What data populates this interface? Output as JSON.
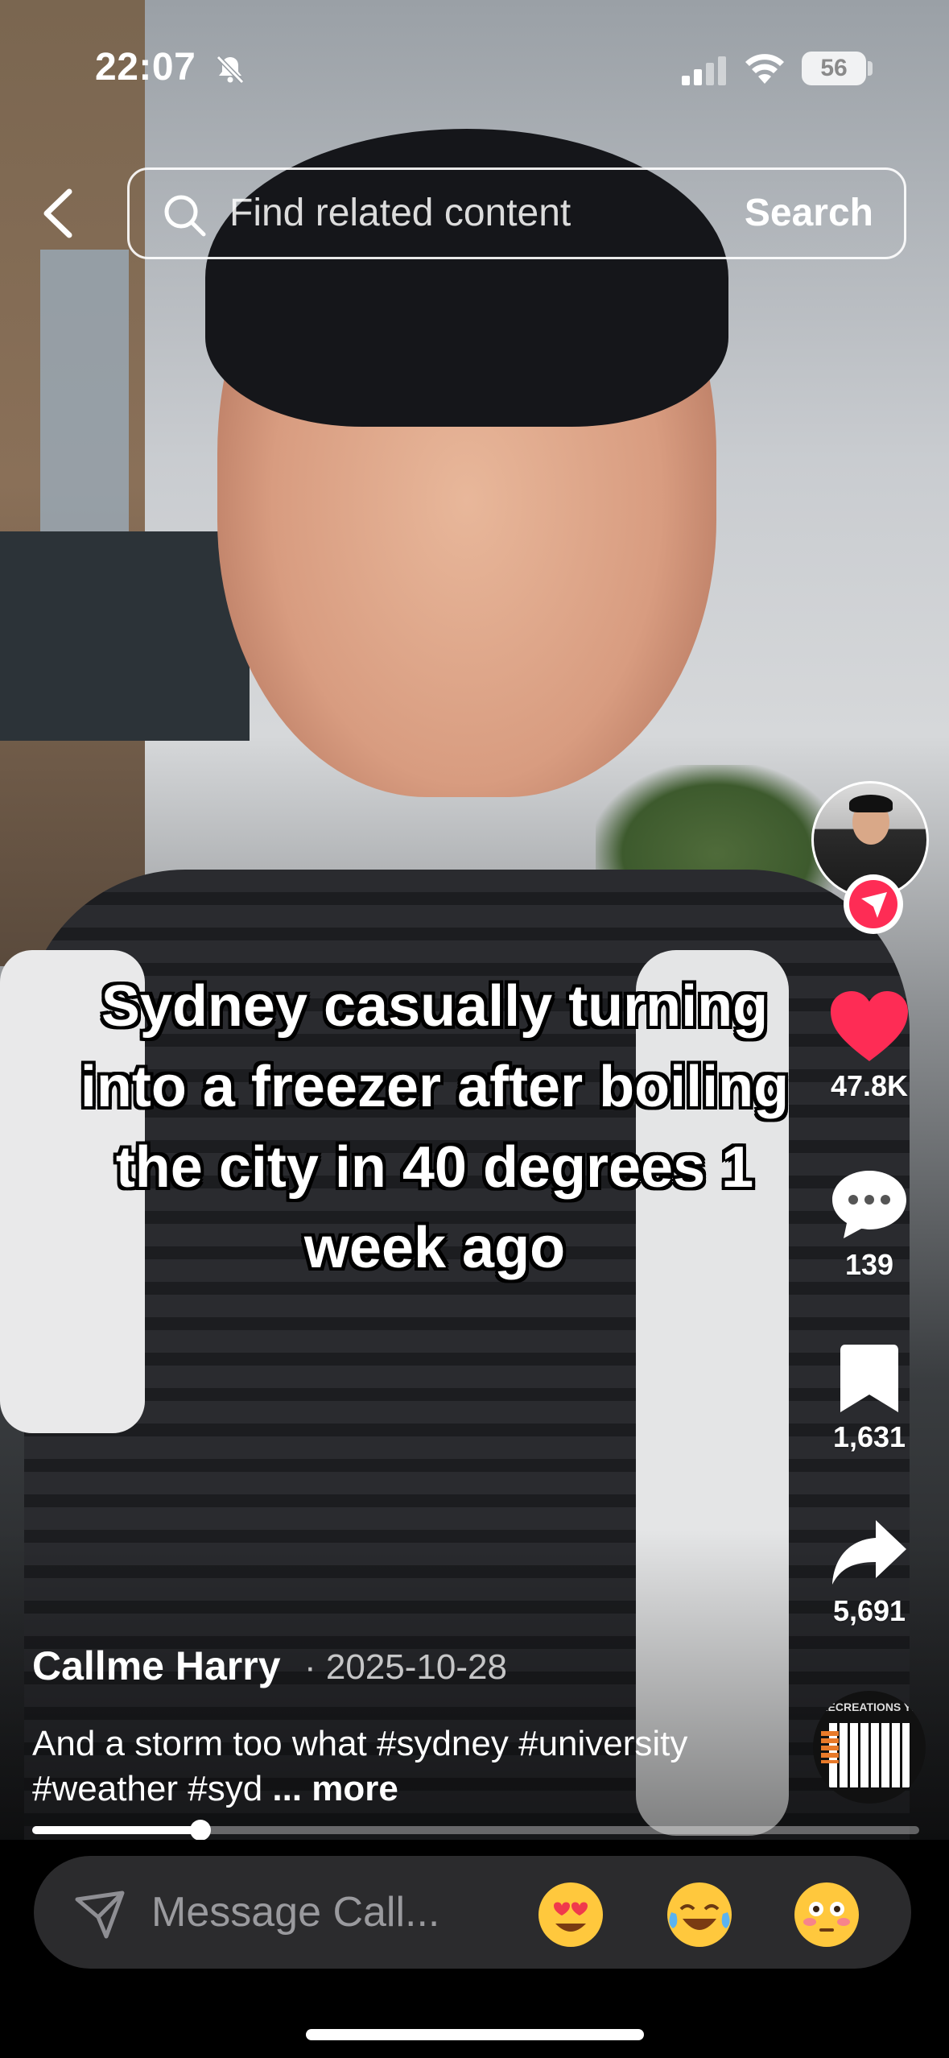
{
  "status_bar": {
    "time": "22:07",
    "battery": "56",
    "icons": [
      "bell-off-icon",
      "signal-icon",
      "wifi-icon",
      "battery-icon"
    ]
  },
  "search": {
    "placeholder": "Find related content",
    "button_label": "Search"
  },
  "video": {
    "caption": "Sydney casually turning into a freezer after boiling the city in 40 degrees 1 week ago",
    "progress_fraction": 0.19
  },
  "actions": {
    "likes": "47.8K",
    "comments": "139",
    "saves": "1,631",
    "shares": "5,691",
    "like_color": "#fe2c55"
  },
  "post": {
    "author": "Callme Harry",
    "date": "· 2025-10-28",
    "description": "And a storm too what #sydney #university #weather #syd",
    "more_label": "... more"
  },
  "music": {
    "disc_text": "RECREATIONS YE"
  },
  "message_bar": {
    "placeholder": "Message Call...",
    "emojis": [
      "heart-eyes-emoji",
      "tears-of-joy-emoji",
      "flushed-emoji"
    ]
  }
}
